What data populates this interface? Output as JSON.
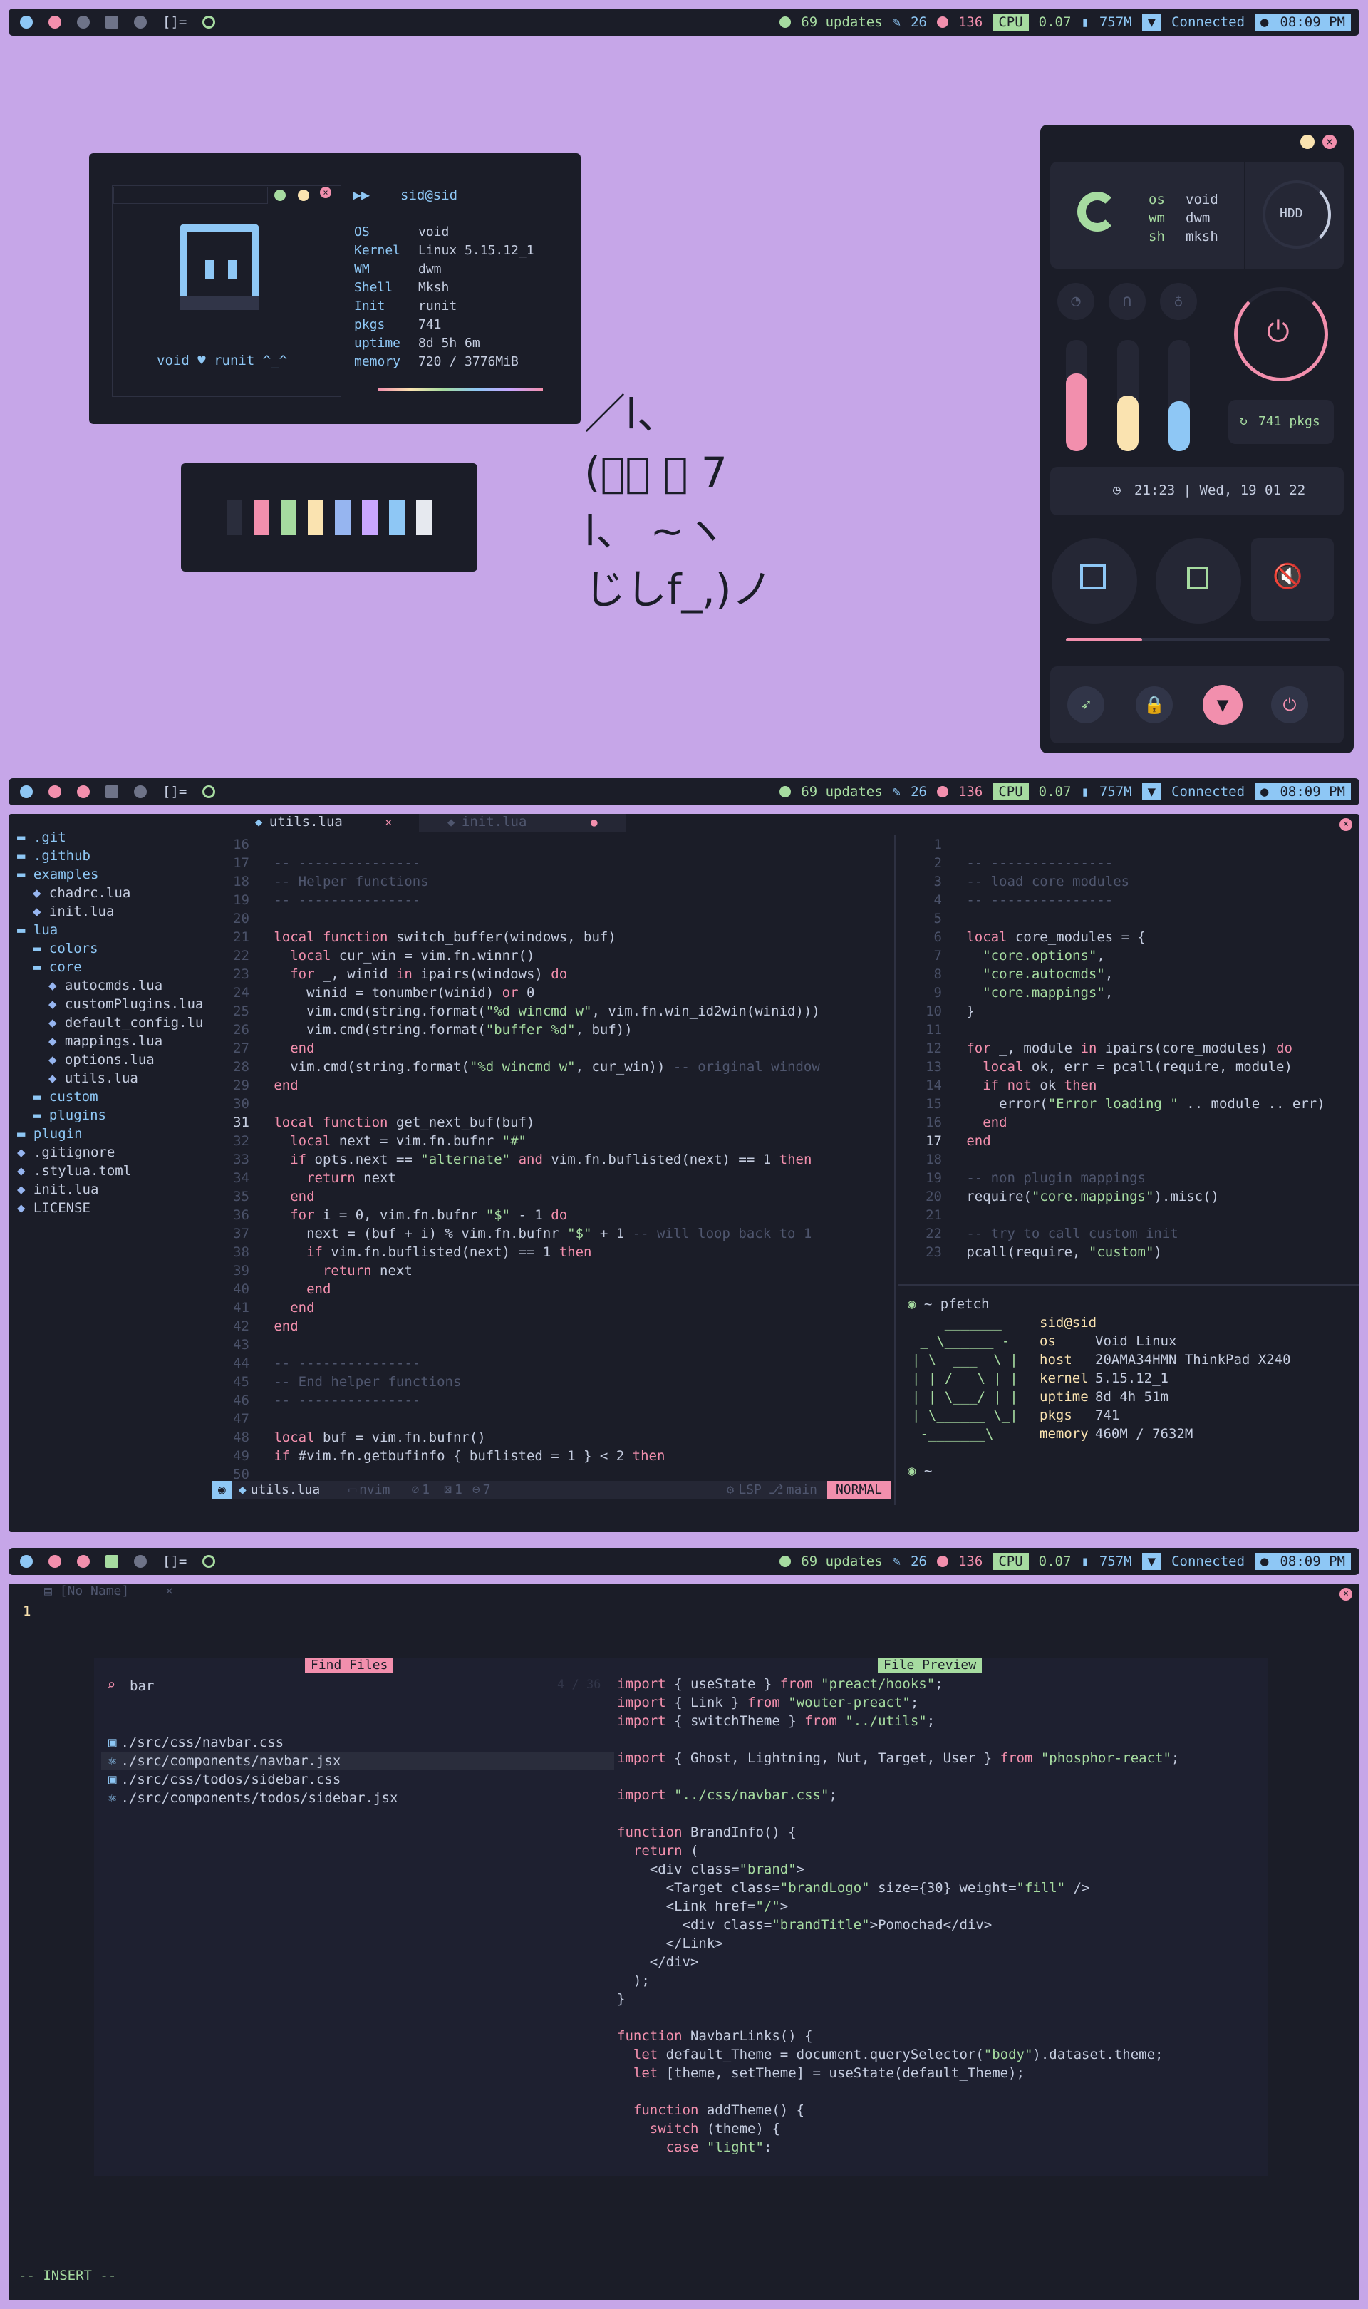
{
  "topbar": {
    "layout": "[]=",
    "updates": "69 updates",
    "brightness": "26",
    "volume": "136",
    "cpu_label": "CPU",
    "cpu_value": "0.07",
    "mem": "757M",
    "network": "Connected",
    "time": "08:09 PM"
  },
  "fetch_widget": {
    "title": "sid@sid",
    "rows": [
      {
        "k": "OS",
        "v": "void"
      },
      {
        "k": "Kernel",
        "v": "Linux 5.15.12_1"
      },
      {
        "k": "WM",
        "v": "dwm"
      },
      {
        "k": "Shell",
        "v": "Mksh"
      },
      {
        "k": "Init",
        "v": "runit"
      },
      {
        "k": "pkgs",
        "v": "741"
      },
      {
        "k": "uptime",
        "v": "8d 5h 6m"
      },
      {
        "k": "memory",
        "v": "720 / 3776MiB"
      }
    ],
    "caption": "void  ♥ runit ^_^"
  },
  "ascii_art": "／l、\n(ﾟ､ ｡ 7\nl、 ~ヽ\nじしf_,)ノ",
  "control_panel": {
    "sys_keys": [
      "os",
      "wm",
      "sh"
    ],
    "sys_vals": [
      "void",
      "dwm",
      "mksh"
    ],
    "hdd_label": "HDD",
    "pkgs": "741 pkgs",
    "datetime": "21:23 | Wed, 19 01 22",
    "slider_levels": [
      0.7,
      0.5,
      0.45
    ],
    "progress": 0.29
  },
  "editor": {
    "tabs": [
      "utils.lua",
      "init.lua"
    ],
    "tree": [
      {
        "name": ".git",
        "indent": 0,
        "color": "#8ec7f5"
      },
      {
        "name": ".github",
        "indent": 0,
        "color": "#8ec7f5"
      },
      {
        "name": "examples",
        "indent": 0,
        "color": "#8ec7f5"
      },
      {
        "name": "chadrc.lua",
        "indent": 1,
        "color": "#c5cde0"
      },
      {
        "name": "init.lua",
        "indent": 1,
        "color": "#c5cde0"
      },
      {
        "name": "lua",
        "indent": 0,
        "color": "#8ec7f5"
      },
      {
        "name": "colors",
        "indent": 1,
        "color": "#8ec7f5"
      },
      {
        "name": "core",
        "indent": 1,
        "color": "#8ec7f5"
      },
      {
        "name": "autocmds.lua",
        "indent": 2,
        "color": "#c5cde0"
      },
      {
        "name": "customPlugins.lua",
        "indent": 2,
        "color": "#c5cde0"
      },
      {
        "name": "default_config.lu",
        "indent": 2,
        "color": "#c5cde0"
      },
      {
        "name": "mappings.lua",
        "indent": 2,
        "color": "#c5cde0"
      },
      {
        "name": "options.lua",
        "indent": 2,
        "color": "#c5cde0"
      },
      {
        "name": "utils.lua",
        "indent": 2,
        "color": "#c5cde0"
      },
      {
        "name": "custom",
        "indent": 1,
        "color": "#8ec7f5"
      },
      {
        "name": "plugins",
        "indent": 1,
        "color": "#8ec7f5"
      },
      {
        "name": "plugin",
        "indent": 0,
        "color": "#8ec7f5"
      },
      {
        "name": ".gitignore",
        "indent": 0,
        "color": "#c5cde0"
      },
      {
        "name": ".stylua.toml",
        "indent": 0,
        "color": "#c5cde0"
      },
      {
        "name": "init.lua",
        "indent": 0,
        "color": "#c5cde0"
      },
      {
        "name": "LICENSE",
        "indent": 0,
        "color": "#c5cde0"
      }
    ],
    "left_code": [
      [
        "16",
        ""
      ],
      [
        "17",
        "-- ---------------"
      ],
      [
        "18",
        "-- Helper functions"
      ],
      [
        "19",
        "-- ---------------"
      ],
      [
        "20",
        ""
      ],
      [
        "21",
        "local function switch_buffer(windows, buf)"
      ],
      [
        "22",
        "  local cur_win = vim.fn.winnr()"
      ],
      [
        "23",
        "  for _, winid in ipairs(windows) do"
      ],
      [
        "24",
        "    winid = tonumber(winid) or 0"
      ],
      [
        "25",
        "    vim.cmd(string.format(\"%d wincmd w\", vim.fn.win_id2win(winid)))"
      ],
      [
        "26",
        "    vim.cmd(string.format(\"buffer %d\", buf))"
      ],
      [
        "27",
        "  end"
      ],
      [
        "28",
        "  vim.cmd(string.format(\"%d wincmd w\", cur_win)) -- original window"
      ],
      [
        "29",
        "end"
      ],
      [
        "30",
        ""
      ],
      [
        "31",
        "local function get_next_buf(buf)"
      ],
      [
        "32",
        "  local next = vim.fn.bufnr \"#\""
      ],
      [
        "33",
        "  if opts.next == \"alternate\" and vim.fn.buflisted(next) == 1 then"
      ],
      [
        "34",
        "    return next"
      ],
      [
        "35",
        "  end"
      ],
      [
        "36",
        "  for i = 0, vim.fn.bufnr \"$\" - 1 do"
      ],
      [
        "37",
        "    next = (buf + i) % vim.fn.bufnr \"$\" + 1 -- will loop back to 1"
      ],
      [
        "38",
        "    if vim.fn.buflisted(next) == 1 then"
      ],
      [
        "39",
        "      return next"
      ],
      [
        "40",
        "    end"
      ],
      [
        "41",
        "  end"
      ],
      [
        "42",
        "end"
      ],
      [
        "43",
        ""
      ],
      [
        "44",
        "-- ---------------"
      ],
      [
        "45",
        "-- End helper functions"
      ],
      [
        "46",
        "-- ---------------"
      ],
      [
        "47",
        ""
      ],
      [
        "48",
        "local buf = vim.fn.bufnr()"
      ],
      [
        "49",
        "if #vim.fn.getbufinfo { buflisted = 1 } < 2 then"
      ],
      [
        "50",
        ""
      ]
    ],
    "right_code": [
      [
        "1",
        ""
      ],
      [
        "2",
        "-- ---------------"
      ],
      [
        "3",
        "-- load core modules"
      ],
      [
        "4",
        "-- ---------------"
      ],
      [
        "5",
        ""
      ],
      [
        "6",
        "local core_modules = {"
      ],
      [
        "7",
        "  \"core.options\","
      ],
      [
        "8",
        "  \"core.autocmds\","
      ],
      [
        "9",
        "  \"core.mappings\","
      ],
      [
        "10",
        "}"
      ],
      [
        "11",
        ""
      ],
      [
        "12",
        "for _, module in ipairs(core_modules) do"
      ],
      [
        "13",
        "  local ok, err = pcall(require, module)"
      ],
      [
        "14",
        "  if not ok then"
      ],
      [
        "15",
        "    error(\"Error loading \" .. module .. err)"
      ],
      [
        "16",
        "  end"
      ],
      [
        "17",
        "end"
      ],
      [
        "18",
        ""
      ],
      [
        "19",
        "-- non plugin mappings"
      ],
      [
        "20",
        "require(\"core.mappings\").misc()"
      ],
      [
        "21",
        ""
      ],
      [
        "22",
        "-- try to call custom init"
      ],
      [
        "23",
        "pcall(require, \"custom\")"
      ]
    ],
    "statusline": {
      "file": "utils.lua",
      "dir": "nvim",
      "s1": "1",
      "s2": "1",
      "s3": "7",
      "lsp": "LSP",
      "branch": "main",
      "mode": "NORMAL"
    },
    "pfetch": {
      "prompt": "~ pfetch",
      "logo": "    _______\n _ \\______ -\n| \\  ___  \\ |\n| | /   \\ | |\n| | \\___/ | |\n| \\______ \\_|\n -_______\\",
      "user": "sid@sid",
      "rows": [
        {
          "k": "os",
          "v": "Void Linux"
        },
        {
          "k": "host",
          "v": "20AMA34HMN ThinkPad X240"
        },
        {
          "k": "kernel",
          "v": "5.15.12_1"
        },
        {
          "k": "uptime",
          "v": "8d 4h 51m"
        },
        {
          "k": "pkgs",
          "v": "741"
        },
        {
          "k": "memory",
          "v": "460M / 7632M"
        }
      ],
      "prompt2": "~"
    }
  },
  "finder": {
    "tab": "[No Name]",
    "line_number": "1",
    "title": "Find Files",
    "query": "bar",
    "count": "4 / 36",
    "results": [
      "./src/css/navbar.css",
      "./src/components/navbar.jsx",
      "./src/css/todos/sidebar.css",
      "./src/components/todos/sidebar.jsx"
    ],
    "preview_title": "File Preview",
    "preview": [
      "import { useState } from \"preact/hooks\";",
      "import { Link } from \"wouter-preact\";",
      "import { switchTheme } from \"../utils\";",
      "",
      "import { Ghost, Lightning, Nut, Target, User } from \"phosphor-react\";",
      "",
      "import \"../css/navbar.css\";",
      "",
      "function BrandInfo() {",
      "  return (",
      "    <div class=\"brand\">",
      "      <Target class=\"brandLogo\" size={30} weight=\"fill\" />",
      "      <Link href=\"/\">",
      "        <div class=\"brandTitle\">Pomochad</div>",
      "      </Link>",
      "    </div>",
      "  );",
      "}",
      "",
      "function NavbarLinks() {",
      "  let default_Theme = document.querySelector(\"body\").dataset.theme;",
      "  let [theme, setTheme] = useState(default_Theme);",
      "",
      "  function addTheme() {",
      "    switch (theme) {",
      "      case \"light\":"
    ],
    "mode": "-- INSERT --"
  }
}
